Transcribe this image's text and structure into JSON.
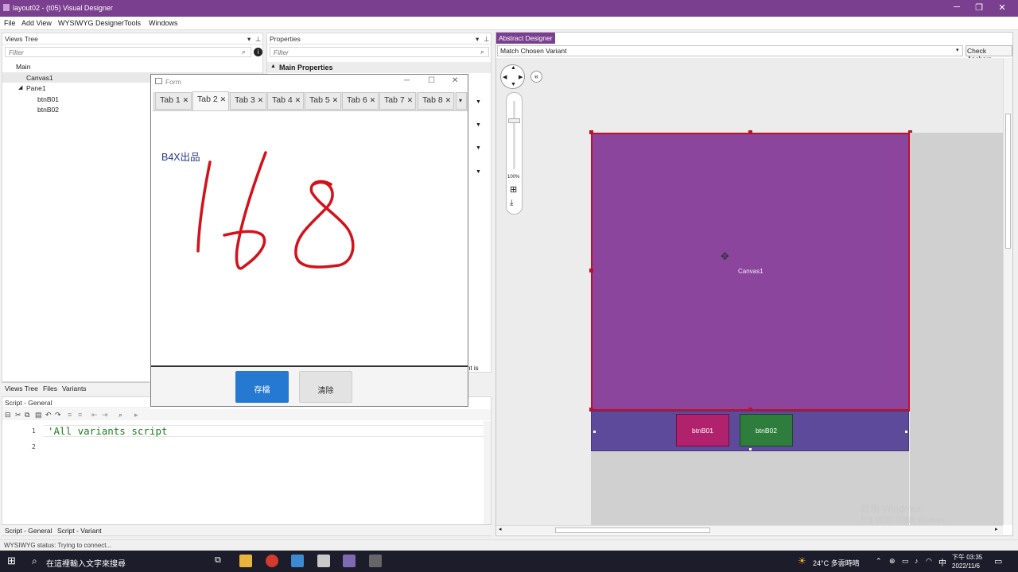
{
  "window": {
    "title": "layout02 - (t05) Visual Designer"
  },
  "menu": [
    "File",
    "Add View",
    "WYSIWYG Designer",
    "Tools",
    "Windows"
  ],
  "views_tree": {
    "header": "Views Tree",
    "filter_placeholder": "Filter",
    "items": [
      "Main",
      "Canvas1",
      "Pane1",
      "btnB01",
      "btnB02"
    ]
  },
  "left_tabs": [
    "Views Tree",
    "Files",
    "Variants"
  ],
  "properties": {
    "header": "Properties",
    "filter_placeholder": "Filter",
    "section": "Main Properties",
    "partial_text": "nt is"
  },
  "script": {
    "header": "Script - General",
    "lines": [
      {
        "num": "1",
        "code": "'All variants script"
      },
      {
        "num": "2",
        "code": ""
      }
    ],
    "tabs": [
      "Script - General",
      "Script - Variant"
    ]
  },
  "form": {
    "title": "Form",
    "tabs": [
      "Tab 1",
      "Tab 2",
      "Tab 3",
      "Tab 4",
      "Tab 5",
      "Tab 6",
      "Tab 7",
      "Tab 8"
    ],
    "active_tab": "Tab 2",
    "label": "B4X出品",
    "save_button": "存檔",
    "clear_button": "清除"
  },
  "designer": {
    "tab": "Abstract Designer",
    "variant_select": "Match Chosen Variant",
    "check_anchors": "Check Anchors",
    "zoom": "100%",
    "canvas_label": "Canvas1",
    "btn1": "btnB01",
    "btn2": "btnB02",
    "colors": {
      "canvas": "#8b459d",
      "pane": "#5e4a9a",
      "btn1": "#b0226c",
      "btn2": "#2f7d3c"
    },
    "watermark1": "啟用 Windows",
    "watermark2": "移至 [設定] 以啟用 Windows。"
  },
  "status": "WYSIWYG status: Trying to connect...",
  "taskbar": {
    "search_placeholder": "在這裡輸入文字來搜尋",
    "weather": "24°C 多雲時晴",
    "ime": "中",
    "time": "下午 03:35",
    "date": "2022/11/6"
  }
}
